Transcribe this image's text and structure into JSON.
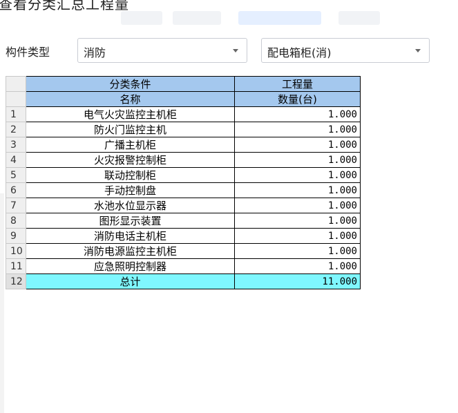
{
  "window": {
    "title": "查看分类汇总工程量"
  },
  "filters": {
    "component_type_label": "构件类型",
    "component_type_value": "消防",
    "sub_type_value": "配电箱柜(消)"
  },
  "table": {
    "group_header": "分类条件",
    "quantity_header": "工程量",
    "name_header": "名称",
    "unit_header": "数量(台)",
    "rows": [
      {
        "index": "1",
        "name": "电气火灾监控主机柜",
        "qty": "1.000"
      },
      {
        "index": "2",
        "name": "防火门监控主机",
        "qty": "1.000"
      },
      {
        "index": "3",
        "name": "广播主机柜",
        "qty": "1.000"
      },
      {
        "index": "4",
        "name": "火灾报警控制柜",
        "qty": "1.000"
      },
      {
        "index": "5",
        "name": "联动控制柜",
        "qty": "1.000"
      },
      {
        "index": "6",
        "name": "手动控制盘",
        "qty": "1.000"
      },
      {
        "index": "7",
        "name": "水池水位显示器",
        "qty": "1.000"
      },
      {
        "index": "8",
        "name": "图形显示装置",
        "qty": "1.000"
      },
      {
        "index": "9",
        "name": "消防电话主机柜",
        "qty": "1.000"
      },
      {
        "index": "10",
        "name": "消防电源监控主机柜",
        "qty": "1.000"
      },
      {
        "index": "11",
        "name": "应急照明控制器",
        "qty": "1.000"
      }
    ],
    "total": {
      "index": "12",
      "name": "总计",
      "qty": "11.000"
    }
  },
  "colors": {
    "header_bg": "#a4c8ee",
    "total_bg": "#7ff7ff"
  }
}
